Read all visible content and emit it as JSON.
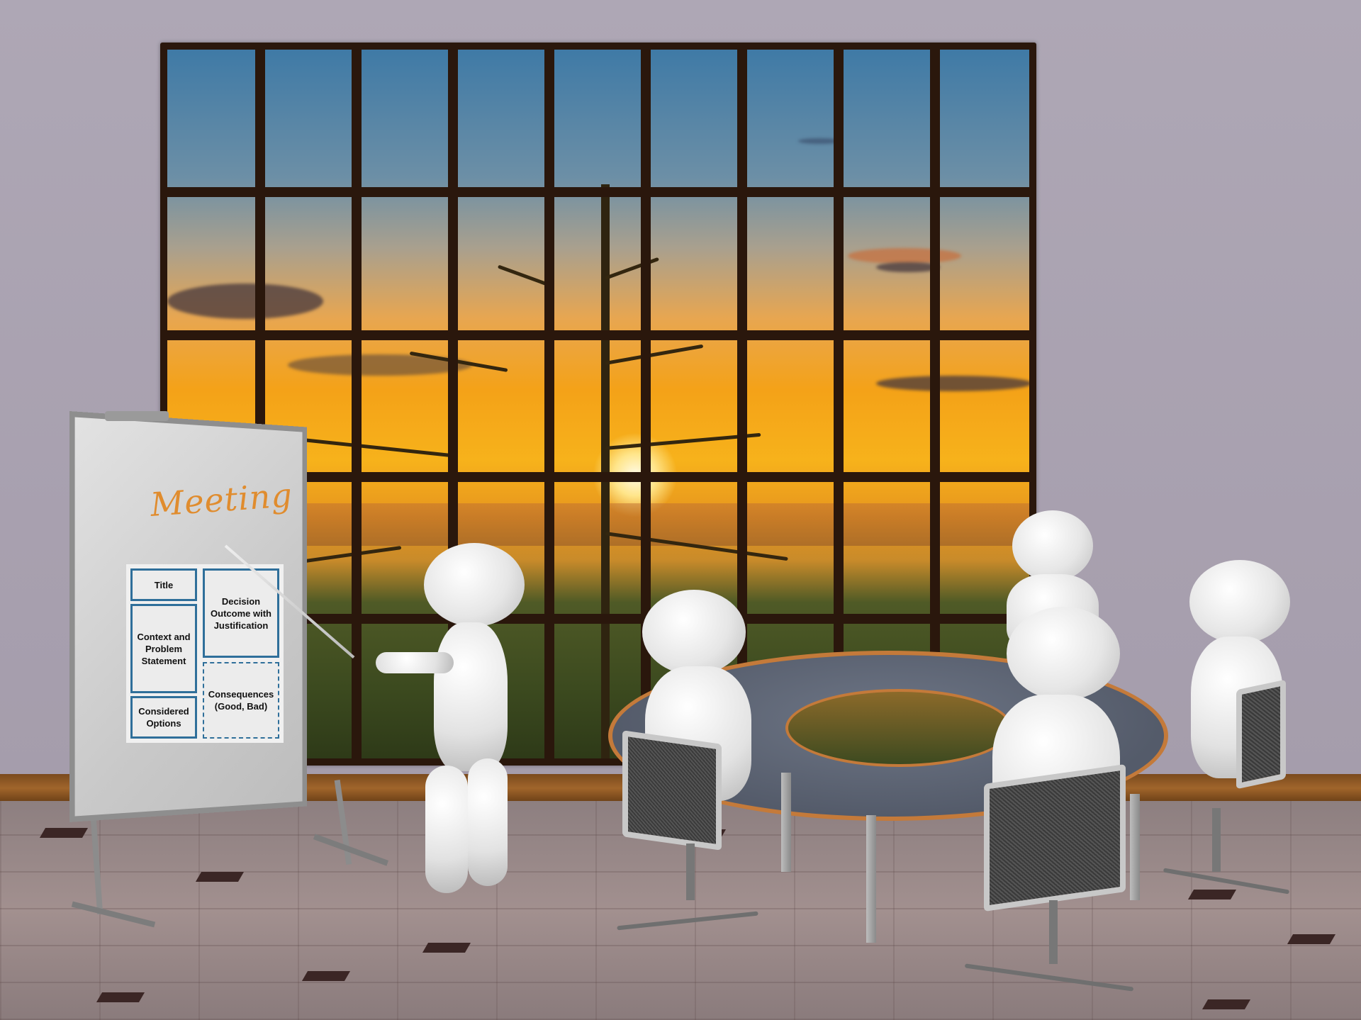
{
  "scene": {
    "description": "3D rendered meeting room with figures around a table and a presenter at a flipchart in front of a sunset window"
  },
  "flipchart": {
    "title": "Meeting",
    "title_color": "#e08c2e",
    "sections": [
      {
        "id": "title",
        "label": "Title",
        "style": "solid"
      },
      {
        "id": "context",
        "label": "Context and Problem Statement",
        "style": "solid"
      },
      {
        "id": "options",
        "label": "Considered Options",
        "style": "solid"
      },
      {
        "id": "decision",
        "label": "Decision Outcome with Justification",
        "style": "solid"
      },
      {
        "id": "consequences",
        "label": "Consequences (Good, Bad)",
        "style": "dashed"
      }
    ],
    "box_border_color": "#2f6f9a"
  },
  "colors": {
    "wall": "#aea7b5",
    "window_frame": "#2a170c",
    "table_edge": "#c47a3a",
    "table_top": "#5e6575"
  }
}
